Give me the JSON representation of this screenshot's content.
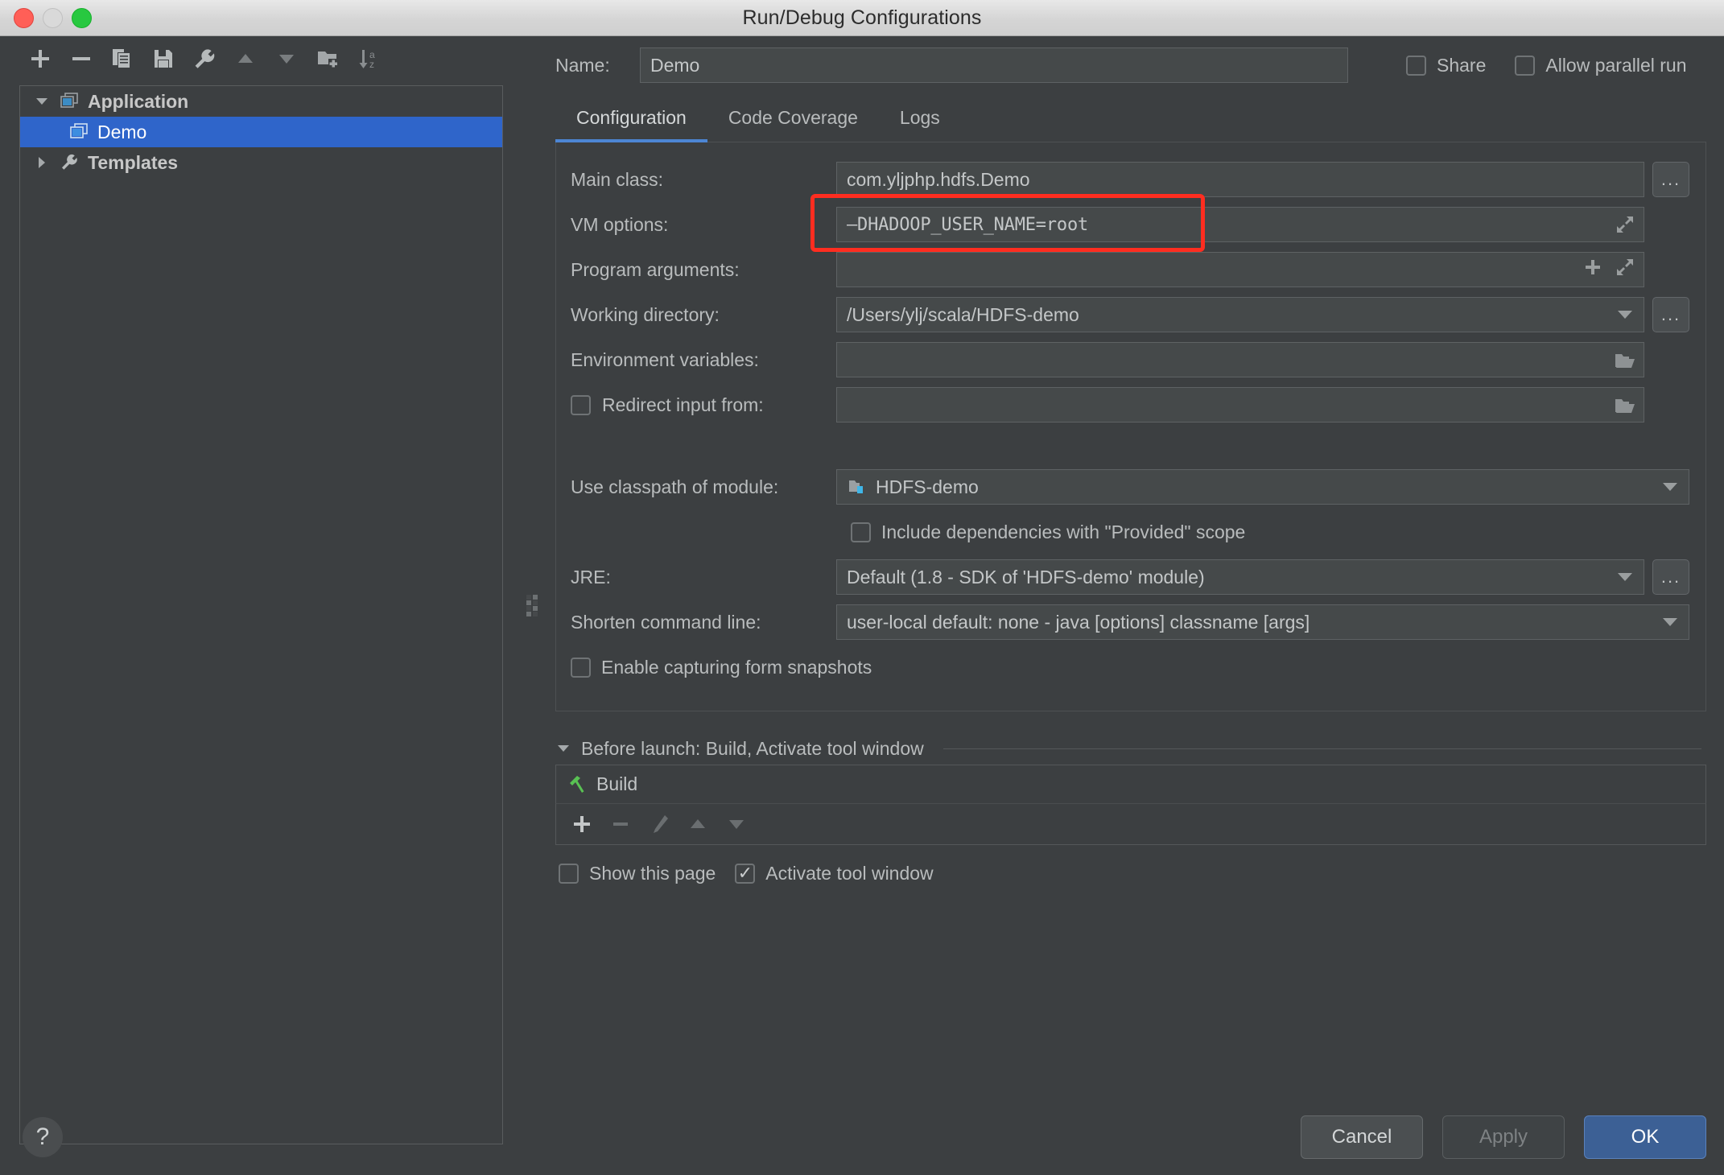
{
  "window": {
    "title": "Run/Debug Configurations"
  },
  "toolbar": {
    "buttons": [
      {
        "name": "add-configuration-button",
        "icon": "plus-icon",
        "tooltip": "Add New Configuration"
      },
      {
        "name": "remove-configuration-button",
        "icon": "minus-icon",
        "tooltip": "Remove Configuration"
      },
      {
        "name": "copy-configuration-button",
        "icon": "copy-icon",
        "tooltip": "Copy Configuration"
      },
      {
        "name": "save-configuration-button",
        "icon": "save-icon",
        "tooltip": "Save Configuration"
      },
      {
        "name": "edit-templates-button",
        "icon": "wrench-icon",
        "tooltip": "Edit Templates"
      },
      {
        "name": "move-up-button",
        "icon": "triangle-up-icon",
        "tooltip": "Move Up"
      },
      {
        "name": "move-down-button",
        "icon": "triangle-down-icon",
        "tooltip": "Move Down"
      },
      {
        "name": "new-folder-button",
        "icon": "folder-add-icon",
        "tooltip": "Create New Folder"
      },
      {
        "name": "sort-button",
        "icon": "sort-az-icon",
        "tooltip": "Sort Configurations"
      }
    ]
  },
  "tree": {
    "items": [
      {
        "label": "Application",
        "icon": "application-icon",
        "expanded": true,
        "selected": false,
        "level": 0
      },
      {
        "label": "Demo",
        "icon": "application-icon",
        "expanded": null,
        "selected": true,
        "level": 1
      },
      {
        "label": "Templates",
        "icon": "wrench-icon",
        "expanded": false,
        "selected": false,
        "level": 0
      }
    ]
  },
  "header": {
    "name_label": "Name:",
    "name_value": "Demo",
    "share": {
      "label": "Share",
      "checked": false
    },
    "allow_parallel_run": {
      "label": "Allow parallel run",
      "checked": false
    }
  },
  "tabs": [
    {
      "label": "Configuration",
      "active": true
    },
    {
      "label": "Code Coverage",
      "active": false
    },
    {
      "label": "Logs",
      "active": false
    }
  ],
  "configuration": {
    "main_class": {
      "label": "Main class:",
      "value": "com.yljphp.hdfs.Demo",
      "browse_label": "..."
    },
    "vm_options": {
      "label": "VM options:",
      "value": "–DHADOOP_USER_NAME=root",
      "highlighted": true,
      "highlight_color": "#ff2d20"
    },
    "program_arguments": {
      "label": "Program arguments:",
      "value": ""
    },
    "working_directory": {
      "label": "Working directory:",
      "value": "/Users/ylj/scala/HDFS-demo",
      "browse_label": "..."
    },
    "environment_variables": {
      "label": "Environment variables:",
      "value": ""
    },
    "redirect_input_from": {
      "label": "Redirect input from:",
      "checked": false,
      "value": ""
    },
    "use_classpath_of_module": {
      "label": "Use classpath of module:",
      "value": "HDFS-demo"
    },
    "include_provided_scope": {
      "label": "Include dependencies with \"Provided\" scope",
      "checked": false
    },
    "jre": {
      "label": "JRE:",
      "value_bright": "Default",
      "value_dim": "(1.8 - SDK of 'HDFS-demo' module)",
      "browse_label": "..."
    },
    "shorten_command_line": {
      "label": "Shorten command line:",
      "value_bright": "user-local default: none",
      "value_dim": "- java [options] classname [args]"
    },
    "enable_capturing_form_snapshots": {
      "label": "Enable capturing form snapshots",
      "checked": false
    }
  },
  "before_launch": {
    "title": "Before launch: Build, Activate tool window",
    "expanded": true,
    "items": [
      {
        "label": "Build",
        "icon": "build-hammer-icon"
      }
    ],
    "toolbar": [
      {
        "name": "add-task-button",
        "icon": "plus-icon",
        "enabled": true
      },
      {
        "name": "remove-task-button",
        "icon": "minus-icon",
        "enabled": false
      },
      {
        "name": "edit-task-button",
        "icon": "pencil-icon",
        "enabled": false
      },
      {
        "name": "move-task-up-button",
        "icon": "triangle-up-icon",
        "enabled": false
      },
      {
        "name": "move-task-down-button",
        "icon": "triangle-down-icon",
        "enabled": false
      }
    ],
    "show_this_page": {
      "label": "Show this page",
      "checked": false
    },
    "activate_tool_window": {
      "label": "Activate tool window",
      "checked": true
    }
  },
  "footer": {
    "help_label": "?",
    "cancel_label": "Cancel",
    "apply_label": "Apply",
    "apply_enabled": false,
    "ok_label": "OK"
  },
  "colors": {
    "accent": "#4d86d4",
    "selection": "#2f65ca",
    "primary_button": "#3c6095",
    "highlight": "#ff2d20",
    "build_icon": "#59c153",
    "panel_bg": "#3c3f41"
  }
}
